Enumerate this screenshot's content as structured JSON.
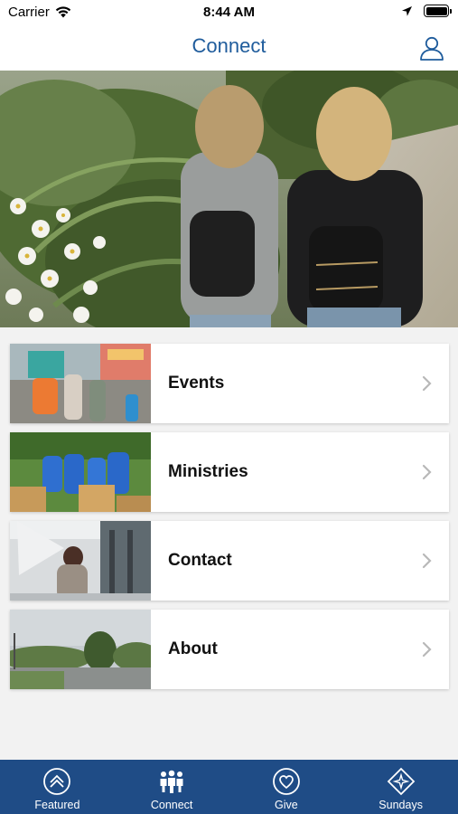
{
  "status_bar": {
    "carrier": "Carrier",
    "time": "8:44 AM",
    "battery_level": 1.0
  },
  "nav": {
    "title": "Connect",
    "profile_icon": "person-icon"
  },
  "colors": {
    "nav_title": "#1f5c9c",
    "tab_bar": "#1f4c86",
    "background": "#f2f2f2"
  },
  "cards": [
    {
      "label": "Events",
      "thumb": "events-photo"
    },
    {
      "label": "Ministries",
      "thumb": "ministries-photo"
    },
    {
      "label": "Contact",
      "thumb": "contact-photo"
    },
    {
      "label": "About",
      "thumb": "about-photo"
    }
  ],
  "tabs": [
    {
      "label": "Featured",
      "icon": "chevron-up-circle-icon"
    },
    {
      "label": "Connect",
      "icon": "people-icon"
    },
    {
      "label": "Give",
      "icon": "heart-circle-icon"
    },
    {
      "label": "Sundays",
      "icon": "diamond-icon"
    }
  ]
}
